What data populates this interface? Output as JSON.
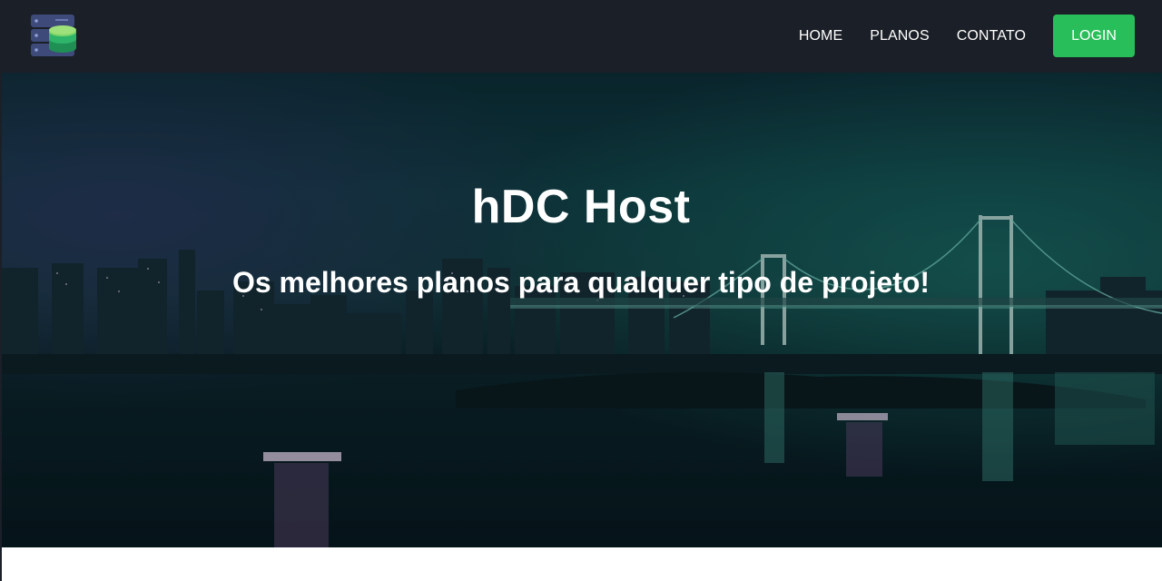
{
  "header": {
    "logo_icon": "server-database-icon",
    "nav": [
      {
        "label": "HOME"
      },
      {
        "label": "PLANOS"
      },
      {
        "label": "CONTATO"
      }
    ],
    "login_label": "LOGIN",
    "colors": {
      "navbar_bg": "#1b1f27",
      "login_bg": "#28bf5a"
    }
  },
  "hero": {
    "title": "hDC Host",
    "subtitle": "Os melhores planos para qualquer tipo de projeto!",
    "background": "night-city-skyline-bridge-image"
  }
}
